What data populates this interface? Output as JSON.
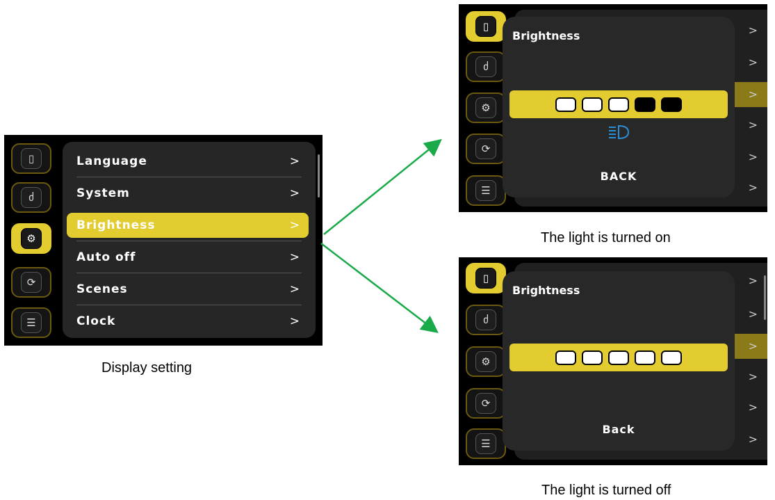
{
  "main_screen": {
    "menu": [
      {
        "label": "Language",
        "chevron": ">"
      },
      {
        "label": "System",
        "chevron": ">"
      },
      {
        "label": "Brightness",
        "chevron": ">"
      },
      {
        "label": "Auto off",
        "chevron": ">"
      },
      {
        "label": "Scenes",
        "chevron": ">"
      },
      {
        "label": "Clock",
        "chevron": ">"
      }
    ],
    "sidebar_icons": [
      "phone-icon",
      "bicycle-icon",
      "gear-icon",
      "refresh-icon",
      "document-icon"
    ],
    "active_icon": "gear-icon",
    "selected_item": "Brightness"
  },
  "captions": {
    "main": "Display setting",
    "on": "The light is turned on",
    "off": "The light is turned off"
  },
  "dialog_on": {
    "title": "Brightness",
    "level": 3,
    "max_level": 5,
    "light_icon": "headlight-icon",
    "back": "BACK"
  },
  "dialog_off": {
    "title": "Brightness",
    "level": 5,
    "max_level": 5,
    "back": "Back"
  },
  "glyphs": {
    "phone": "▯",
    "bicycle": "ძ",
    "gear": "⚙",
    "refresh": "⟳",
    "document": "☰",
    "chevron": ">"
  },
  "colors": {
    "accent": "#e2cc2f",
    "arrow": "#1aaa4a",
    "headlight": "#2b8fd6"
  }
}
